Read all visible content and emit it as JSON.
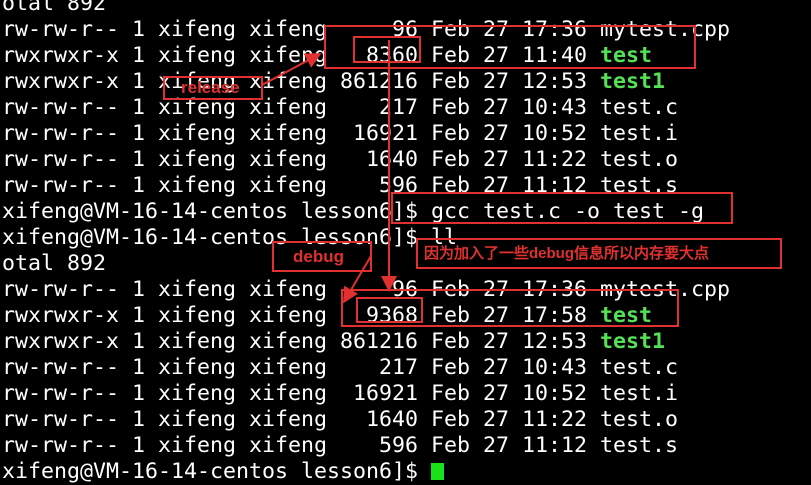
{
  "lines": [
    {
      "prefix": "otal 892",
      "name": ""
    },
    {
      "prefix": "rw-rw-r-- 1 xifeng xifeng     96 Feb 27 17:36 ",
      "name": "mytest.cpp"
    },
    {
      "prefix": "rwxrwxr-x 1 xifeng xifeng   8360 Feb 27 11:40 ",
      "name": "test",
      "exec": true
    },
    {
      "prefix": "rwxrwxr-x 1 xifeng xifeng 861216 Feb 27 12:53 ",
      "name": "test1",
      "exec": true
    },
    {
      "prefix": "rw-rw-r-- 1 xifeng xifeng    217 Feb 27 10:43 ",
      "name": "test.c"
    },
    {
      "prefix": "rw-rw-r-- 1 xifeng xifeng  16921 Feb 27 10:52 ",
      "name": "test.i"
    },
    {
      "prefix": "rw-rw-r-- 1 xifeng xifeng   1640 Feb 27 11:22 ",
      "name": "test.o"
    },
    {
      "prefix": "rw-rw-r-- 1 xifeng xifeng    596 Feb 27 11:12 ",
      "name": "test.s"
    },
    {
      "prefix": "xifeng@VM-16-14-centos lesson6]$ ",
      "name": "gcc test.c -o test -g"
    },
    {
      "prefix": "xifeng@VM-16-14-centos lesson6]$ ",
      "name": "ll"
    },
    {
      "prefix": "otal 892",
      "name": ""
    },
    {
      "prefix": "rw-rw-r-- 1 xifeng xifeng     96 Feb 27 17:36 ",
      "name": "mytest.cpp"
    },
    {
      "prefix": "rwxrwxr-x 1 xifeng xifeng   9368 Feb 27 17:58 ",
      "name": "test",
      "exec": true
    },
    {
      "prefix": "rwxrwxr-x 1 xifeng xifeng 861216 Feb 27 12:53 ",
      "name": "test1",
      "exec": true
    },
    {
      "prefix": "rw-rw-r-- 1 xifeng xifeng    217 Feb 27 10:43 ",
      "name": "test.c"
    },
    {
      "prefix": "rw-rw-r-- 1 xifeng xifeng  16921 Feb 27 10:52 ",
      "name": "test.i"
    },
    {
      "prefix": "rw-rw-r-- 1 xifeng xifeng   1640 Feb 27 11:22 ",
      "name": "test.o"
    },
    {
      "prefix": "rw-rw-r-- 1 xifeng xifeng    596 Feb 27 11:12 ",
      "name": "test.s"
    },
    {
      "prefix": "xifeng@VM-16-14-centos lesson6]$ ",
      "name": "",
      "cursor": true
    }
  ],
  "annotations": {
    "release_label": "release",
    "debug_label": "debug",
    "note": "因为加入了一些debug信息所以内存要大点"
  },
  "colors": {
    "background": "#000000",
    "text": "#ffffff",
    "executable": "#55e055",
    "cursor": "#19e019",
    "annotation": "#e03030"
  }
}
